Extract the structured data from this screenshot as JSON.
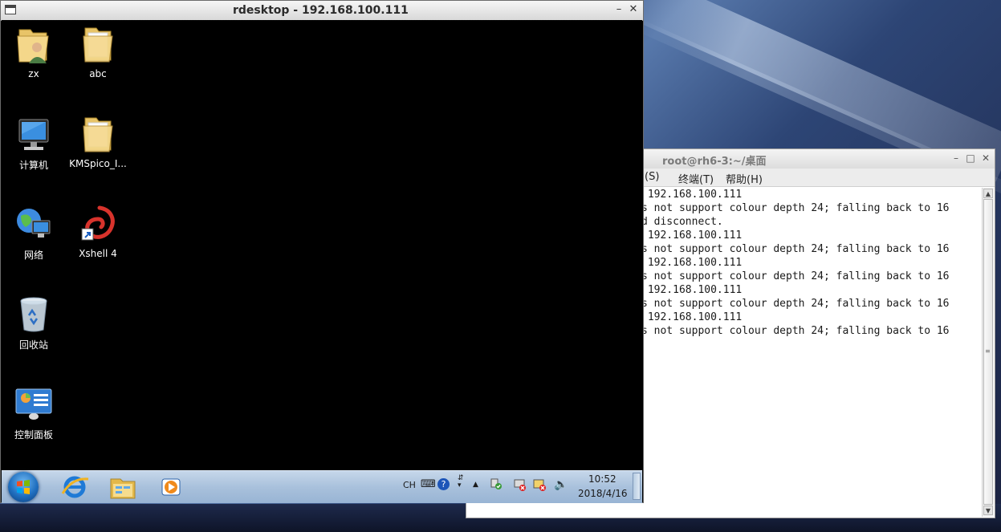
{
  "rdesktop": {
    "title": "rdesktop - 192.168.100.111",
    "minimize": "–",
    "close": "✕"
  },
  "desktop_icons": [
    {
      "label": "zx",
      "icon": "user-folder-icon"
    },
    {
      "label": "abc",
      "icon": "folder-icon"
    },
    {
      "label": "计算机",
      "icon": "computer-icon"
    },
    {
      "label": "KMSpico_I...",
      "icon": "folder-icon"
    },
    {
      "label": "网络",
      "icon": "network-icon"
    },
    {
      "label": "Xshell 4",
      "icon": "xshell-icon"
    },
    {
      "label": "回收站",
      "icon": "recycle-bin-icon"
    },
    {
      "label": "控制面板",
      "icon": "control-panel-icon"
    }
  ],
  "taskbar": {
    "lang": "CH",
    "clock_time": "10:52",
    "clock_date": "2018/4/16"
  },
  "terminal": {
    "title": "root@rh6-3:~/桌面",
    "minimize": "–",
    "maximize": "□",
    "close": "✕",
    "menu": [
      "(S)",
      "终端(T)",
      "帮助(H)"
    ],
    "lines": [
      " 192.168.100.111",
      "s not support colour depth 24; falling back to 16",
      "d disconnect.",
      " 192.168.100.111",
      "s not support colour depth 24; falling back to 16",
      " 192.168.100.111",
      "s not support colour depth 24; falling back to 16",
      " 192.168.100.111",
      "s not support colour depth 24; falling back to 16",
      " 192.168.100.111",
      "s not support colour depth 24; falling back to 16"
    ]
  },
  "colors": {
    "taskbar": "#a9c1dc",
    "terminal_bg": "#ffffff",
    "remote_desktop_bg": "#000000"
  }
}
